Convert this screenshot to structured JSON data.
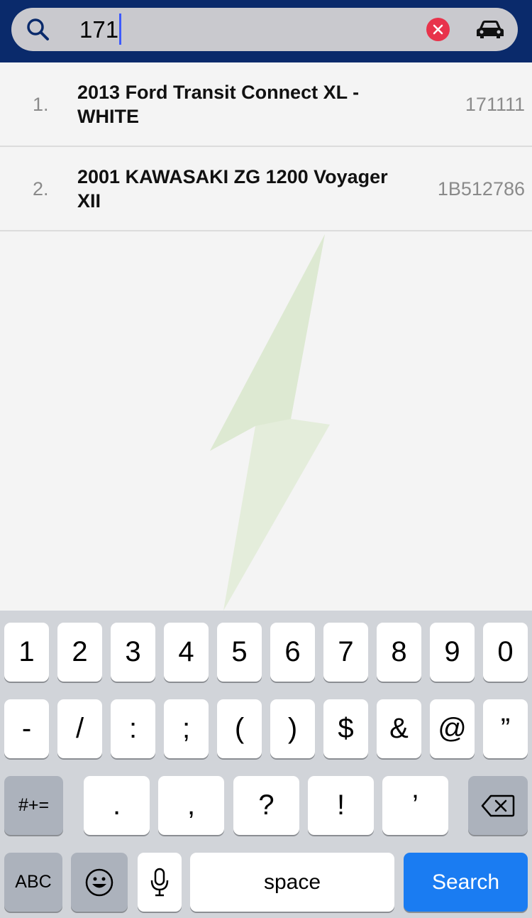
{
  "search": {
    "query": "171",
    "placeholder": ""
  },
  "icons": {
    "search": "search-icon",
    "clear": "close-icon",
    "vehicle": "car-icon",
    "backspace": "backspace-icon",
    "emoji": "emoji-icon",
    "mic": "microphone-icon"
  },
  "colors": {
    "header": "#0a2a6b",
    "clear": "#e8334b",
    "search_key": "#1a7cf2",
    "watermark": "#e2ecd8"
  },
  "results": [
    {
      "index": "1.",
      "title": "2013 Ford Transit Connect XL - WHITE",
      "code": "171111"
    },
    {
      "index": "2.",
      "title": "2001  KAWASAKI ZG 1200 Voyager XII",
      "code": "1B512786"
    }
  ],
  "keyboard": {
    "row1": [
      "1",
      "2",
      "3",
      "4",
      "5",
      "6",
      "7",
      "8",
      "9",
      "0"
    ],
    "row2": [
      "-",
      "/",
      ":",
      ";",
      "(",
      ")",
      "$",
      "&",
      "@",
      "”"
    ],
    "row3": [
      ".",
      ",",
      "?",
      "!",
      "’"
    ],
    "more_symbols": "#+=",
    "abc": "ABC",
    "space": "space",
    "search": "Search"
  }
}
